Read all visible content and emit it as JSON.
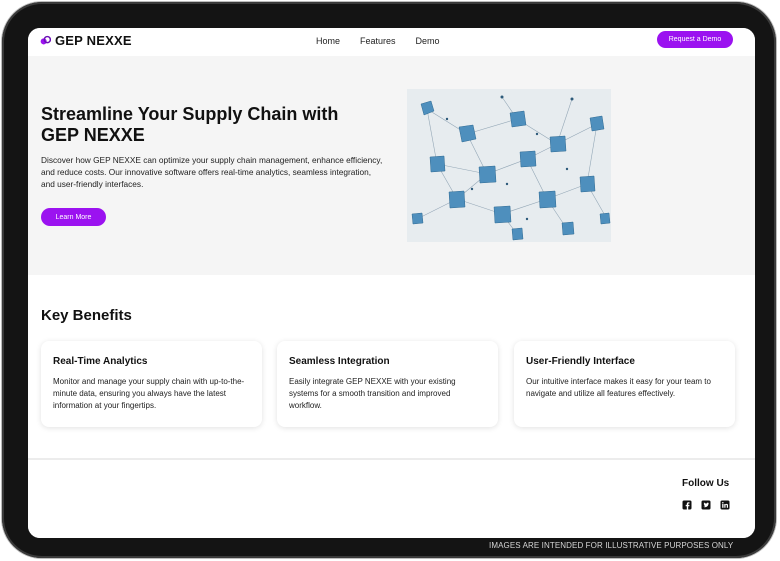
{
  "brand": {
    "name": "GEP NEXXE",
    "accent": "#9b12f0"
  },
  "nav": {
    "links": [
      "Home",
      "Features",
      "Demo"
    ],
    "cta_label": "Request a Demo"
  },
  "hero": {
    "title": "Streamline Your Supply Chain with GEP NEXXE",
    "body": "Discover how GEP NEXXE can optimize your supply chain management, enhance efficiency, and reduce costs. Our innovative software offers real-time analytics, seamless integration, and user-friendly interfaces.",
    "button_label": "Learn More",
    "image_icon": "network-nodes-image"
  },
  "benefits": {
    "title": "Key Benefits",
    "cards": [
      {
        "title": "Real-Time Analytics",
        "body": "Monitor and manage your supply chain with up-to-the-minute data, ensuring you always have the latest information at your fingertips."
      },
      {
        "title": "Seamless Integration",
        "body": "Easily integrate GEP NEXXE with your existing systems for a smooth transition and improved workflow."
      },
      {
        "title": "User-Friendly Interface",
        "body": "Our intuitive interface makes it easy for your team to navigate and utilize all features effectively."
      }
    ]
  },
  "footer": {
    "follow_label": "Follow Us",
    "social_icons": [
      "facebook-icon",
      "twitter-icon",
      "linkedin-icon"
    ]
  },
  "disclaimer": "IMAGES ARE INTENDED FOR ILLUSTRATIVE PURPOSES ONLY"
}
